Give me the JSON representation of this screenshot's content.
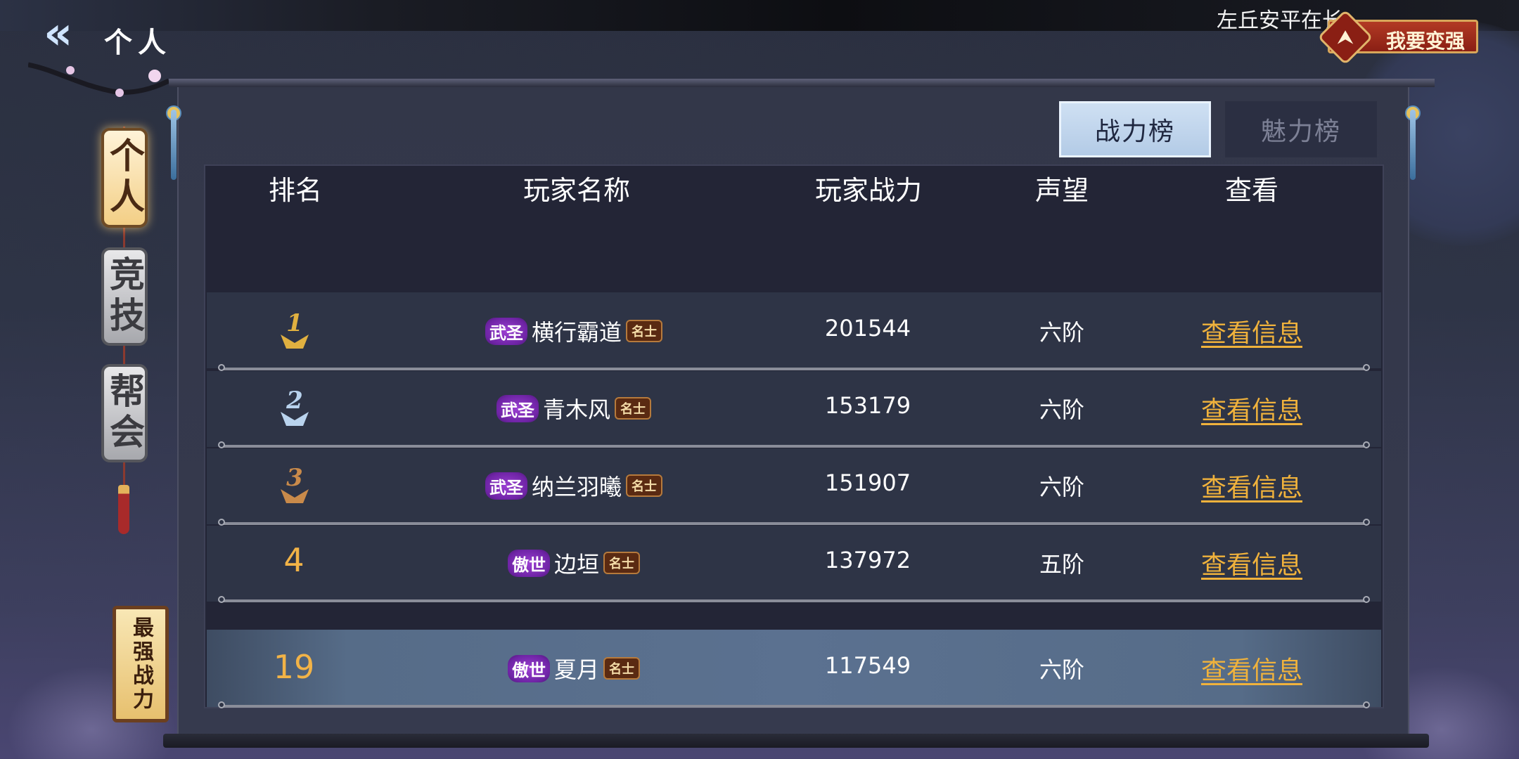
{
  "header": {
    "back_title": "个人",
    "scroll_text": "左丘安平在长",
    "strong_button": "我要变强",
    "strong_icon": "rank-up-icon"
  },
  "side_tabs": [
    {
      "label": "个人",
      "active": true
    },
    {
      "label": "竞技",
      "active": false
    },
    {
      "label": "帮会",
      "active": false
    }
  ],
  "power_tab": "最强战力",
  "rank_tabs": [
    {
      "label": "战力榜",
      "active": true
    },
    {
      "label": "魅力榜",
      "active": false
    }
  ],
  "table": {
    "columns": [
      "排名",
      "玩家名称",
      "玩家战力",
      "声望",
      "查看"
    ],
    "rows": [
      {
        "rank": "1",
        "title": "武圣",
        "name": "横行霸道",
        "badge": "名士",
        "power": "201544",
        "reputation": "六阶",
        "action": "查看信息"
      },
      {
        "rank": "2",
        "title": "武圣",
        "name": "青木风",
        "badge": "名士",
        "power": "153179",
        "reputation": "六阶",
        "action": "查看信息"
      },
      {
        "rank": "3",
        "title": "武圣",
        "name": "纳兰羽曦",
        "badge": "名士",
        "power": "151907",
        "reputation": "六阶",
        "action": "查看信息"
      },
      {
        "rank": "4",
        "title": "傲世",
        "name": "边垣",
        "badge": "名士",
        "power": "137972",
        "reputation": "五阶",
        "action": "查看信息"
      }
    ],
    "self_row": {
      "rank": "19",
      "title": "傲世",
      "name": "夏月",
      "badge": "名士",
      "power": "117549",
      "reputation": "六阶",
      "action": "查看信息"
    }
  },
  "colors": {
    "accent_gold": "#f0b23c",
    "title_purple": "#7d2cb5",
    "active_tab": "#c3d6ec",
    "medal_gold": "#e0b040",
    "medal_silver": "#b9d3ee",
    "medal_bronze": "#c98a4a"
  }
}
